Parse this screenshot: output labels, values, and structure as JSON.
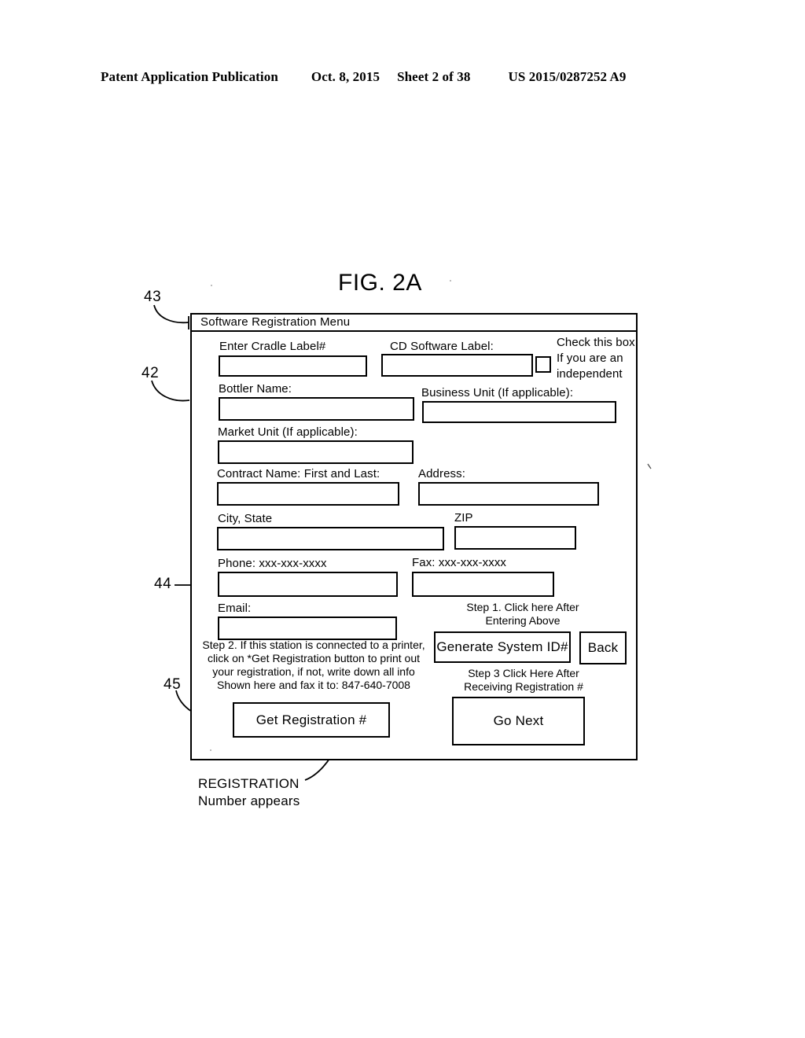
{
  "page_header": {
    "title": "Patent Application Publication",
    "date": "Oct. 8, 2015",
    "sheet": "Sheet 2 of 38",
    "publication_number": "US 2015/0287252 A9"
  },
  "figure": {
    "caption": "FIG. 2A",
    "reference_numerals": {
      "title_bar": "43",
      "dialog_panel": "42",
      "phone_field": "44",
      "get_registration_button": "45"
    }
  },
  "dialog": {
    "title": "Software Registration Menu",
    "fields": {
      "cradle_label": {
        "label": "Enter Cradle Label#",
        "value": ""
      },
      "cd_software_label": {
        "label": "CD Software Label:",
        "value": ""
      },
      "independent_checkbox": {
        "label": "Check this box\nIf you are an\nindependent",
        "checked": false
      },
      "bottler_name": {
        "label": "Bottler Name:",
        "value": ""
      },
      "business_unit": {
        "label": "Business Unit (If applicable):",
        "value": ""
      },
      "market_unit": {
        "label": "Market Unit (If applicable):",
        "value": ""
      },
      "contract_name": {
        "label": "Contract Name: First and Last:",
        "value": ""
      },
      "address": {
        "label": "Address:",
        "value": ""
      },
      "city_state": {
        "label": "City, State",
        "value": ""
      },
      "zip": {
        "label": "ZIP",
        "value": ""
      },
      "phone": {
        "label": "Phone:  xxx-xxx-xxxx",
        "value": ""
      },
      "fax": {
        "label": "Fax:  xxx-xxx-xxxx",
        "value": ""
      },
      "email": {
        "label": "Email:",
        "value": ""
      }
    },
    "instructions": {
      "step1": "Step 1. Click here After\nEntering Above",
      "step2": "Step 2. If this station is connected to a printer,\nclick on *Get Registration button to print out\nyour registration, if not, write down all info\nShown here and fax it to: 847-640-7008",
      "step3": "Step 3 Click Here After\nReceiving Registration #"
    },
    "buttons": {
      "generate_system_id": "Generate System ID#",
      "back": "Back",
      "get_registration": "Get Registration #",
      "go_next": "Go Next"
    }
  },
  "annotation": {
    "registration_note": "REGISTRATION\nNumber appears"
  }
}
